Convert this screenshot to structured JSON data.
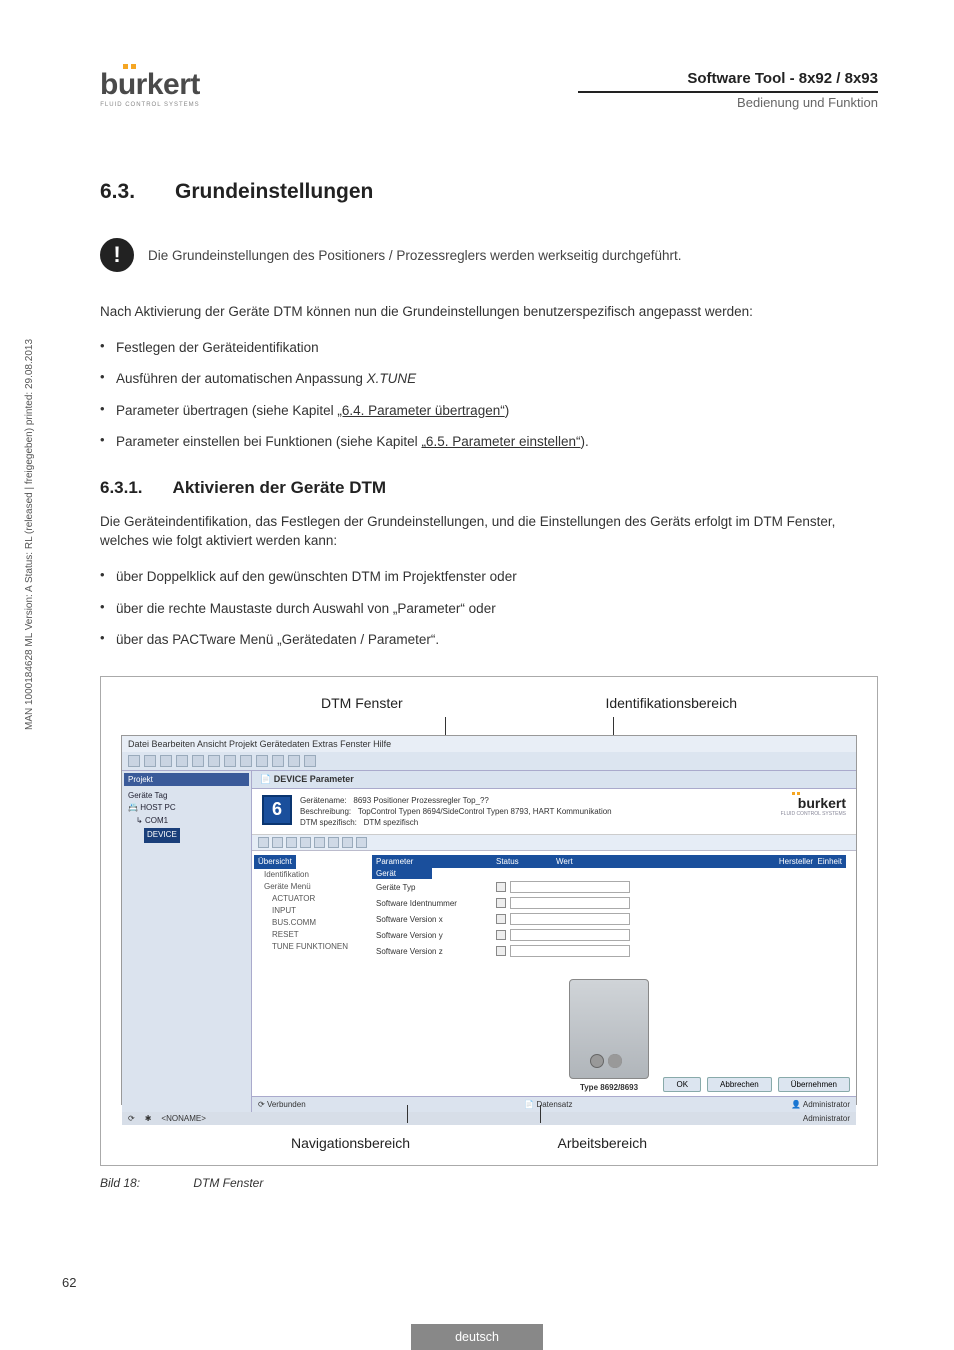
{
  "header": {
    "logo_text": "burkert",
    "logo_sub": "FLUID CONTROL SYSTEMS",
    "right_title": "Software Tool - 8x92 / 8x93",
    "right_sub": "Bedienung und Funktion"
  },
  "section": {
    "num": "6.3.",
    "title": "Grundeinstellungen"
  },
  "note": "Die Grundeinstellungen des Positioners / Prozessreglers werden werkseitig durchgeführt.",
  "intro": "Nach Aktivierung der Geräte DTM können nun die Grundeinstellungen benutzerspezifisch angepasst werden:",
  "bullets_a": {
    "b1": "Festlegen der Geräteidentifikation",
    "b2_pre": "Ausführen der automatischen Anpassung ",
    "b2_it": "X.TUNE",
    "b3_pre": "Parameter übertragen (siehe Kapitel ",
    "b3_link": "„6.4. Parameter übertragen“",
    "b3_post": ")",
    "b4_pre": "Parameter einstellen bei Funktionen (siehe Kapitel ",
    "b4_link": "„6.5. Parameter einstellen“",
    "b4_post": ")."
  },
  "subsection": {
    "num": "6.3.1.",
    "title": "Aktivieren der Geräte DTM"
  },
  "para_b": "Die Geräteindentifikation, das Festlegen der Grundeinstellungen, und die Einstellungen des Geräts erfolgt im DTM Fenster, welches wie folgt aktiviert werden kann:",
  "bullets_b": {
    "b1": "über Doppelklick auf den gewünschten DTM im Projektfenster oder",
    "b2": "über die rechte Maustaste durch Auswahl von „Parameter“ oder",
    "b3": "über das PACTware Menü „Gerätedaten / Parameter“."
  },
  "fig": {
    "top_left": "DTM Fenster",
    "top_right": "Identifikationsbereich",
    "bottom_left": "Navigationsbereich",
    "bottom_right": "Arbeitsbereich"
  },
  "screenshot": {
    "menubar": "Datei   Bearbeiten   Ansicht   Projekt   Gerätedaten   Extras   Fenster   Hilfe",
    "sidebar_hdr": "Projekt",
    "tree": {
      "t1": "Geräte Tag",
      "t2": "HOST PC",
      "t3": "COM1",
      "t4": "DEVICE"
    },
    "tab": "DEVICE Parameter",
    "ident": {
      "six": "6",
      "l1": "Gerätename:",
      "v1": "8693 Positioner Prozessregler Top_??",
      "l2": "Beschreibung:",
      "v2": "TopControl Typen 8694/SideControl Typen 8793, HART Kommunikation",
      "l3": "DTM spezifisch:",
      "v3": "DTM spezifisch",
      "logo": "burkert",
      "logo_sub": "FLUID CONTROL SYSTEMS"
    },
    "nav": {
      "n0": "Übersicht",
      "n1": "Identifikation",
      "n2": "Geräte Menü",
      "n3": "ACTUATOR",
      "n4": "INPUT",
      "n5": "BUS.COMM",
      "n6": "RESET",
      "n7": "TUNE FUNKTIONEN"
    },
    "table": {
      "h1": "Parameter",
      "h2": "Status",
      "h3": "Wert",
      "h4": "Hersteller",
      "h5": "Einheit",
      "grp": "Gerät",
      "r1": "Geräte Typ",
      "r2": "Software Identnummer",
      "r3": "Software Version x",
      "r4": "Software Version y",
      "r5": "Software Version z"
    },
    "device_label": "Type 8692/8693",
    "btns": {
      "ok": "OK",
      "abort": "Abbrechen",
      "apply": "Übernehmen"
    },
    "status_left": "Verbunden",
    "status_mid": "Datensatz",
    "status_right": "Administrator",
    "footer_left": "<NONAME>",
    "footer_right": "Administrator"
  },
  "caption": {
    "num": "Bild 18:",
    "text": "DTM Fenster"
  },
  "side_text": "MAN 1000184628 ML Version: A Status: RL (released | freigegeben) printed: 29.08.2013",
  "page_number": "62",
  "footer_lang": "deutsch"
}
